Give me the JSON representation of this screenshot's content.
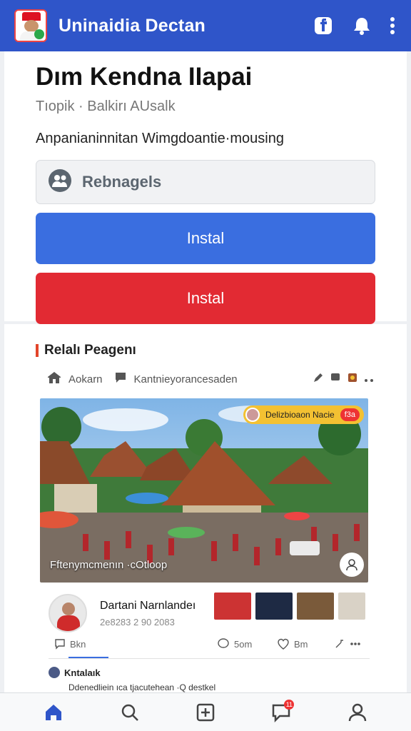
{
  "header": {
    "app_title": "Uninaidia Dectan",
    "icons": [
      "app-logo",
      "facebook-icon",
      "bell-icon",
      "more-vertical-icon"
    ]
  },
  "main": {
    "title": "Dım Kendna IIapai",
    "subtitle": "Tıopik · Balkirı AUsalk",
    "description": "Anpanianinnitan Wimgdoantie·mousing",
    "field_label": "Rebnagels",
    "primary_button": "Instal",
    "secondary_button": "Instal"
  },
  "feed": {
    "section_title": "Relalı Peagenı",
    "post_meta": {
      "category": "Aokarn",
      "channel": "Kantnieyorancesaden"
    },
    "photo": {
      "caption": "Fftenymcmenın ·cOtloop",
      "live_label": "Delizbioaon Nacie",
      "live_badge": "f3a"
    },
    "author": {
      "name": "Dartani Narnlandeı",
      "meta": "2e8283 2 90 2083"
    },
    "actions": {
      "comments": "Bkn",
      "reactions": "5om",
      "likes": "Bm"
    },
    "comment": {
      "user": "Kntalaık",
      "text": "Ddenedliein ıca tjacutehean ·Q destkel"
    }
  },
  "bottom_nav": {
    "items": [
      "home-icon",
      "search-icon",
      "add-icon",
      "notifications-icon",
      "profile-icon"
    ],
    "badge": "11"
  },
  "colors": {
    "brand_blue": "#2f55c9",
    "button_blue": "#3a6ee0",
    "button_red": "#e22a33",
    "accent_orange": "#e2452a"
  }
}
